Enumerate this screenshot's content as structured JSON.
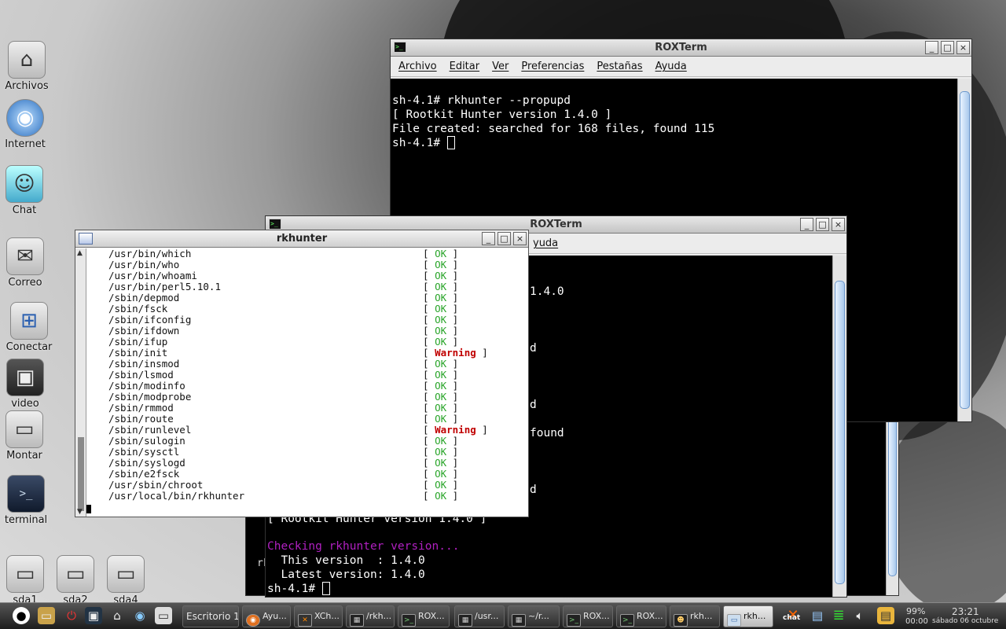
{
  "desktop": {
    "icons": [
      {
        "label": "Archivos",
        "glyph": "⌂"
      },
      {
        "label": "Internet",
        "glyph": "◉"
      },
      {
        "label": "Chat",
        "glyph": "☺"
      },
      {
        "label": "Correo",
        "glyph": "✉"
      },
      {
        "label": "Conectar",
        "glyph": "⊞"
      },
      {
        "label": "video",
        "glyph": "▣"
      },
      {
        "label": "Montar",
        "glyph": "▭"
      },
      {
        "label": "terminal",
        "glyph": ">_"
      },
      {
        "label": "sda1",
        "glyph": "▭"
      },
      {
        "label": "sda2",
        "glyph": "▭"
      },
      {
        "label": "sda4",
        "glyph": "▭"
      }
    ]
  },
  "roxterm_top": {
    "title": "ROXTerm",
    "menu": [
      "Archivo",
      "Editar",
      "Ver",
      "Preferencias",
      "Pestañas",
      "Ayuda"
    ],
    "lines": [
      "sh-4.1# rkhunter --propupd",
      "[ Rootkit Hunter version 1.4.0 ]",
      "File created: searched for 168 files, found 115",
      "sh-4.1# "
    ]
  },
  "roxterm_mid": {
    "title": "ROXTerm",
    "menu_partial": "yuda",
    "fragments": [
      "1.4.0",
      "d",
      "d",
      "found",
      "d"
    ],
    "bottom_lines": {
      "partial": "[ Rootkit Hunter version 1.4.0 ]",
      "checking": "Checking rkhunter version...",
      "this_version": "  This version  : 1.4.0",
      "latest_version": "  Latest version: 1.4.0",
      "prompt": "sh-4.1# "
    },
    "behind_fragment": "rk"
  },
  "rkhunter_win": {
    "title": "rkhunter",
    "rows": [
      {
        "path": "/usr/bin/which",
        "status": "OK"
      },
      {
        "path": "/usr/bin/who",
        "status": "OK"
      },
      {
        "path": "/usr/bin/whoami",
        "status": "OK"
      },
      {
        "path": "/usr/bin/perl5.10.1",
        "status": "OK"
      },
      {
        "path": "/sbin/depmod",
        "status": "OK"
      },
      {
        "path": "/sbin/fsck",
        "status": "OK"
      },
      {
        "path": "/sbin/ifconfig",
        "status": "OK"
      },
      {
        "path": "/sbin/ifdown",
        "status": "OK"
      },
      {
        "path": "/sbin/ifup",
        "status": "OK"
      },
      {
        "path": "/sbin/init",
        "status": "Warning"
      },
      {
        "path": "/sbin/insmod",
        "status": "OK"
      },
      {
        "path": "/sbin/lsmod",
        "status": "OK"
      },
      {
        "path": "/sbin/modinfo",
        "status": "OK"
      },
      {
        "path": "/sbin/modprobe",
        "status": "OK"
      },
      {
        "path": "/sbin/rmmod",
        "status": "OK"
      },
      {
        "path": "/sbin/route",
        "status": "OK"
      },
      {
        "path": "/sbin/runlevel",
        "status": "Warning"
      },
      {
        "path": "/sbin/sulogin",
        "status": "OK"
      },
      {
        "path": "/sbin/sysctl",
        "status": "OK"
      },
      {
        "path": "/sbin/syslogd",
        "status": "OK"
      },
      {
        "path": "/sbin/e2fsck",
        "status": "OK"
      },
      {
        "path": "/usr/sbin/chroot",
        "status": "OK"
      },
      {
        "path": "/usr/local/bin/rkhunter",
        "status": "OK"
      }
    ]
  },
  "taskbar": {
    "workspace": "Escritorio 1",
    "tasks": [
      {
        "label": "Ayu...",
        "icon": "◉"
      },
      {
        "label": "XCh...",
        "icon": "✕"
      },
      {
        "label": "/rkh...",
        "icon": "▦"
      },
      {
        "label": "ROX...",
        "icon": ">_"
      },
      {
        "label": "/usr...",
        "icon": "▦"
      },
      {
        "label": "~/r...",
        "icon": "▦"
      },
      {
        "label": "ROX...",
        "icon": ">_"
      },
      {
        "label": "ROX...",
        "icon": ">_"
      },
      {
        "label": "rkh...",
        "icon": "☻"
      },
      {
        "label": "rkh...",
        "icon": "▭"
      }
    ],
    "battery": "99%",
    "battery_time": "00:00",
    "clock": "23:21",
    "date": "sábado 06 octubre",
    "tray_chat": "chat"
  }
}
